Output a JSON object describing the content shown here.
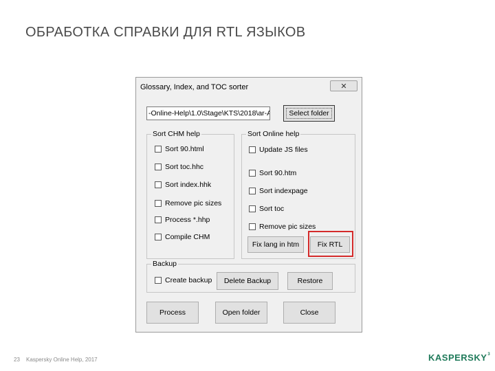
{
  "slide": {
    "title": "ОБРАБОТКА СПРАВКИ ДЛЯ RTL ЯЗЫКОВ",
    "footer_page": "23",
    "footer_text": "Kaspersky Online Help, 2017",
    "logo": "KASPERSKY",
    "logo_mark": "3"
  },
  "dialog": {
    "title": "Glossary, Index, and TOC sorter",
    "close_glyph": "✕",
    "path_value": "-Online-Help\\1.0\\Stage\\KTS\\2018\\ar-AE",
    "select_folder_label": "Select folder",
    "sort_chm": {
      "legend": "Sort CHM help",
      "items": [
        "Sort 90.html",
        "Sort toc.hhc",
        "Sort index.hhk",
        "Remove pic sizes",
        "Process *.hhp",
        "Compile CHM"
      ]
    },
    "sort_online": {
      "legend": "Sort Online help",
      "items": [
        "Update JS files",
        "Sort 90.htm",
        "Sort indexpage",
        "Sort toc",
        "Remove pic sizes"
      ],
      "fix_lang_label": "Fix lang in htm",
      "fix_rtl_label": "Fix RTL"
    },
    "backup": {
      "legend": "Backup",
      "create_backup_label": "Create backup",
      "delete_backup_label": "Delete Backup",
      "restore_label": "Restore"
    },
    "process_label": "Process",
    "open_folder_label": "Open folder",
    "close_label": "Close"
  },
  "colors": {
    "highlight": "#d42a2a",
    "logo": "#1f7a5a"
  }
}
